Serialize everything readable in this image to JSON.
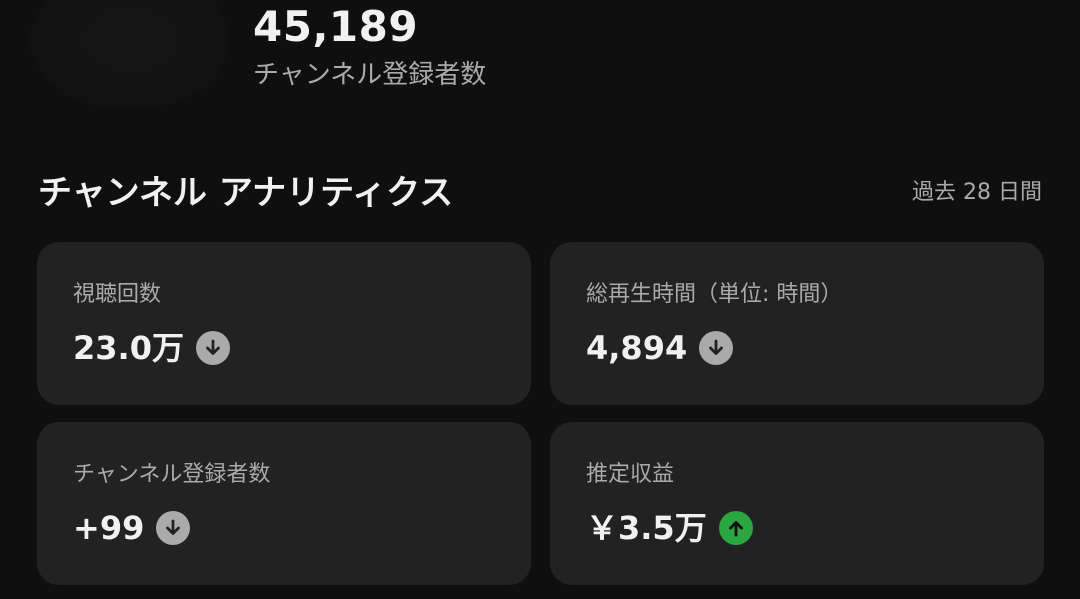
{
  "channel": {
    "subscriber_count": "45,189",
    "subscriber_label": "チャンネル登録者数"
  },
  "analytics": {
    "title": "チャンネル アナリティクス",
    "period": "過去 28 日間",
    "cards": [
      {
        "label": "視聴回数",
        "value": "23.0万",
        "trend": "down",
        "trend_icon": "arrow-down-icon"
      },
      {
        "label": "総再生時間（単位: 時間）",
        "value": "4,894",
        "trend": "down",
        "trend_icon": "arrow-down-icon"
      },
      {
        "label": "チャンネル登録者数",
        "value": "+99",
        "trend": "down",
        "trend_icon": "arrow-down-icon"
      },
      {
        "label": "推定収益",
        "value": "￥3.5万",
        "trend": "up",
        "trend_icon": "arrow-up-icon"
      }
    ]
  },
  "colors": {
    "background": "#0f0f0f",
    "card": "#222222",
    "text_primary": "#f1f1f1",
    "text_secondary": "#aaaaaa",
    "trend_down": "#aaaaaa",
    "trend_up": "#2ba640"
  }
}
